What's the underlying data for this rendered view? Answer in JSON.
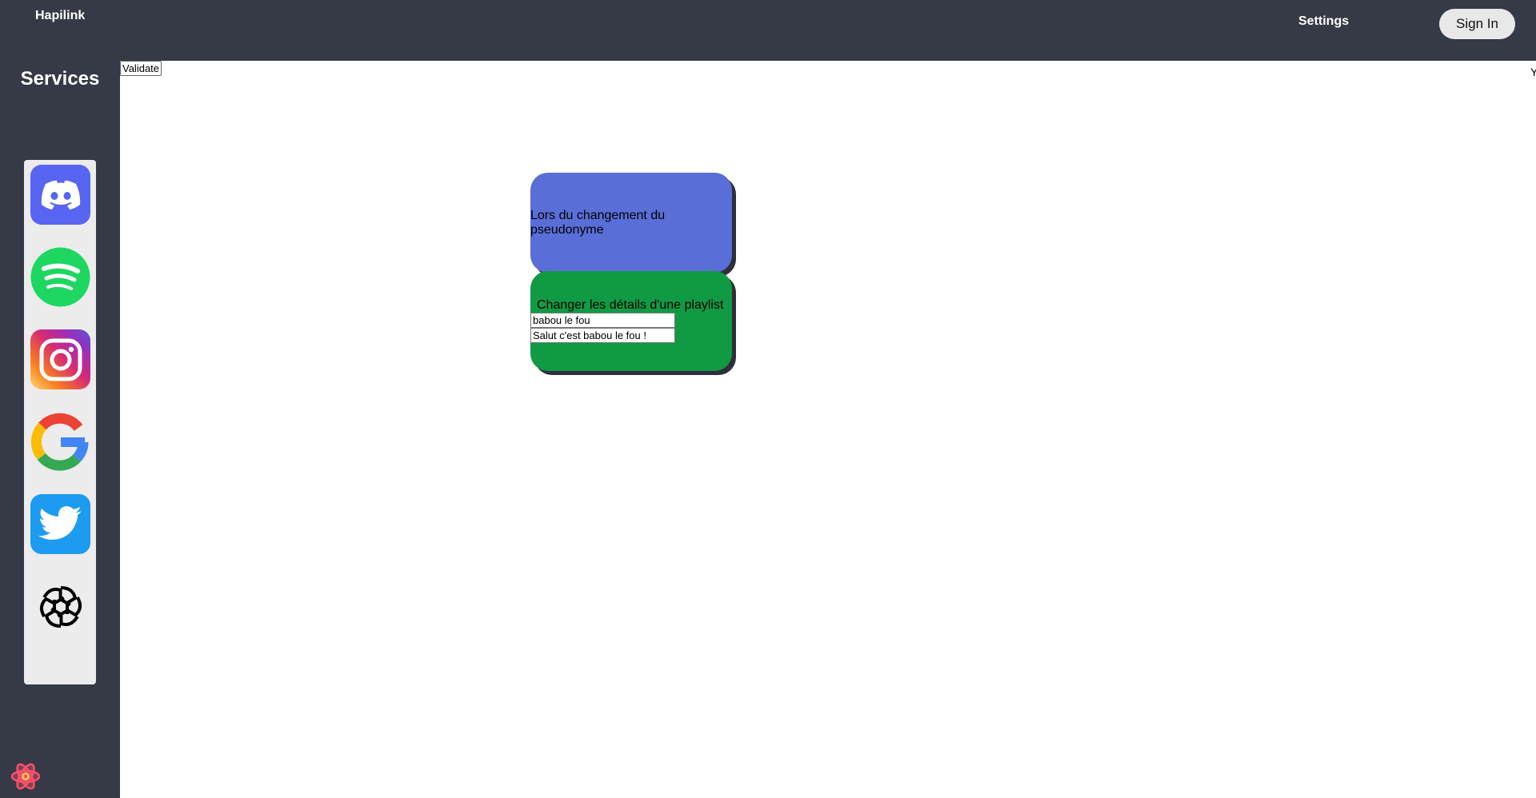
{
  "header": {
    "brand": "Hapilink",
    "settings_label": "Settings",
    "signin_label": "Sign In"
  },
  "sidebar": {
    "title": "Services",
    "services": [
      {
        "name": "Discord",
        "icon": "discord-icon",
        "color": "#5865f2"
      },
      {
        "name": "Spotify",
        "icon": "spotify-icon",
        "color": "#1ed760"
      },
      {
        "name": "Instagram",
        "icon": "instagram-icon",
        "color": "#d62976"
      },
      {
        "name": "Google",
        "icon": "google-icon",
        "color": "#ffffff"
      },
      {
        "name": "Twitter",
        "icon": "twitter-icon",
        "color": "#1d9bf0"
      },
      {
        "name": "OpenAI",
        "icon": "openai-icon",
        "color": "#ffffff"
      }
    ],
    "footer_icon": "react-icon"
  },
  "workspace": {
    "validate_label": "Validate",
    "corner_mark": "Y",
    "trigger_card": {
      "text": "Lors du changement du pseudonyme",
      "color": "#5a6ed8"
    },
    "action_card": {
      "text": "Changer les détails d'une playlist",
      "color": "#109a44",
      "fields": [
        {
          "value": "babou le fou"
        },
        {
          "value": "Salut c'est babou le fou !"
        }
      ]
    }
  }
}
